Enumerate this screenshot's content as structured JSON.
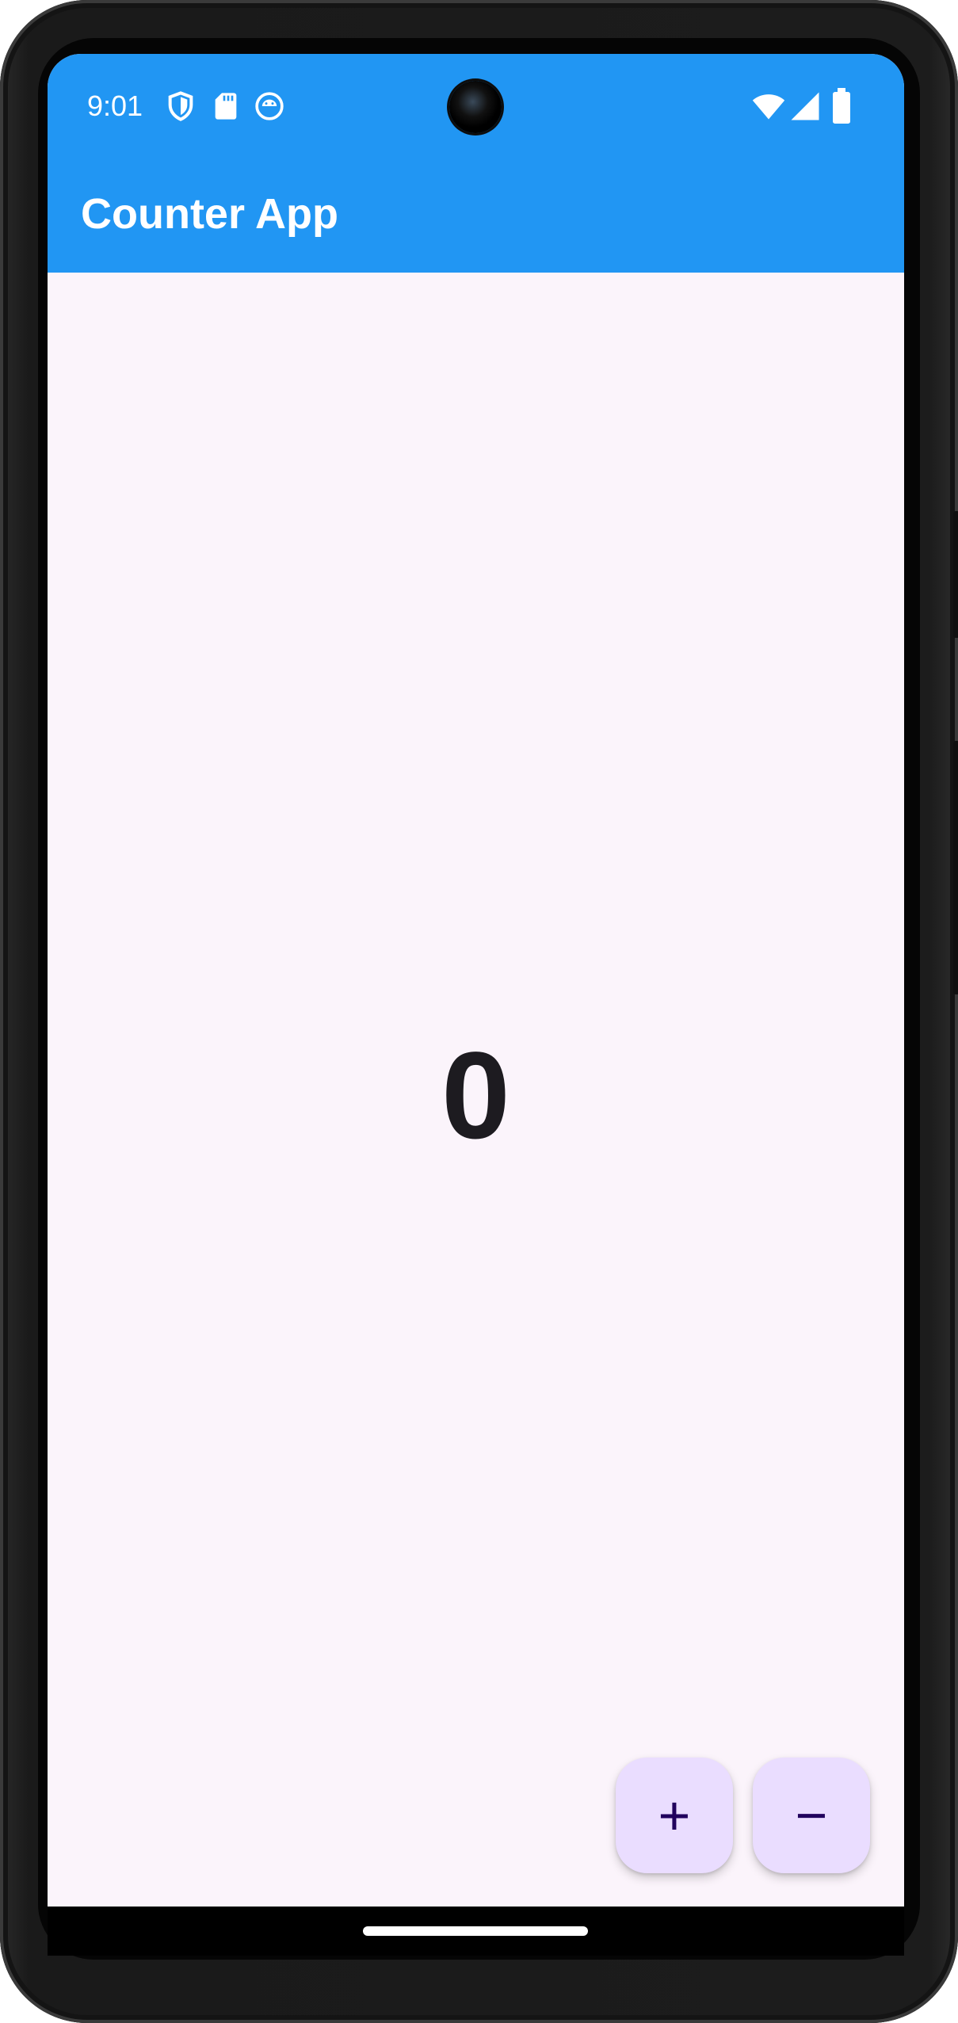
{
  "status_bar": {
    "time": "9:01",
    "icons_left": [
      "shield-icon",
      "sd-card-icon",
      "android-robot-icon"
    ],
    "icons_right": [
      "wifi-icon",
      "cellular-signal-icon",
      "battery-icon"
    ]
  },
  "app_bar": {
    "title": "Counter App",
    "color": "#2196f3"
  },
  "counter": {
    "value": "0"
  },
  "actions": {
    "increment": {
      "glyph": "+",
      "icon": "plus-icon"
    },
    "decrement": {
      "glyph": "−",
      "icon": "minus-icon"
    }
  },
  "theme": {
    "background": "#fbf4fb",
    "fab_background": "#eaddff",
    "fab_foreground": "#21005d"
  }
}
